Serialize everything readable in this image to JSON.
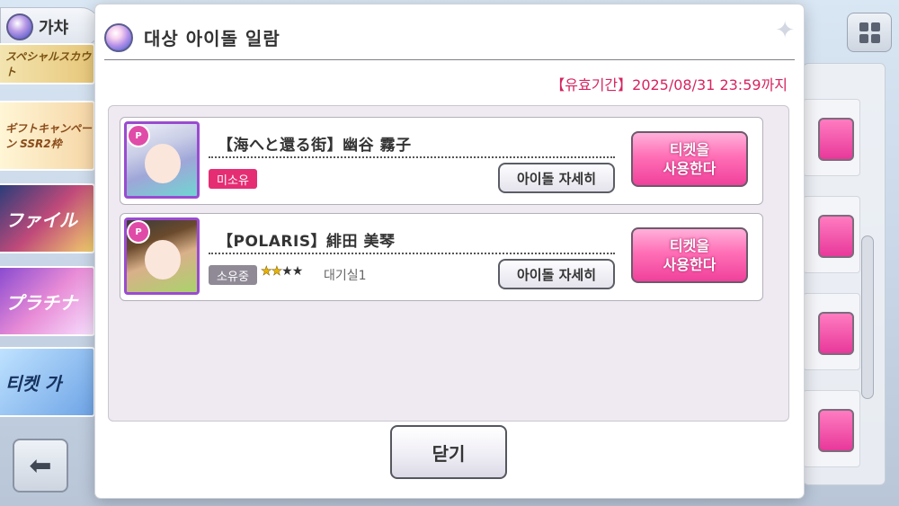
{
  "background": {
    "header_title": "가챠",
    "banners": [
      "スペシャルスカウト",
      "ギフトキャンペーン SSR2枠",
      "ファイル",
      "プラチナ",
      "티켓 가"
    ]
  },
  "modal": {
    "title": "대상 아이돌 일람",
    "validity": "【유효기간】2025/08/31 23:59까지",
    "items": [
      {
        "name": "【海へと還る街】幽谷 霧子",
        "status": "미소유",
        "owned": false,
        "detail_label": "아이돌 자세히",
        "ticket_label_line1": "티켓을",
        "ticket_label_line2": "사용한다"
      },
      {
        "name": "【POLARIS】緋田 美琴",
        "status": "소유중",
        "owned": true,
        "stars_filled": 2,
        "stars_total": 4,
        "room": "대기실1",
        "detail_label": "아이돌 자세히",
        "ticket_label_line1": "티켓을",
        "ticket_label_line2": "사용한다"
      }
    ],
    "close_label": "닫기"
  },
  "colors": {
    "accent_pink": "#f0419b",
    "validity_red": "#d6245f",
    "frame_purple": "#9a4bd0"
  }
}
